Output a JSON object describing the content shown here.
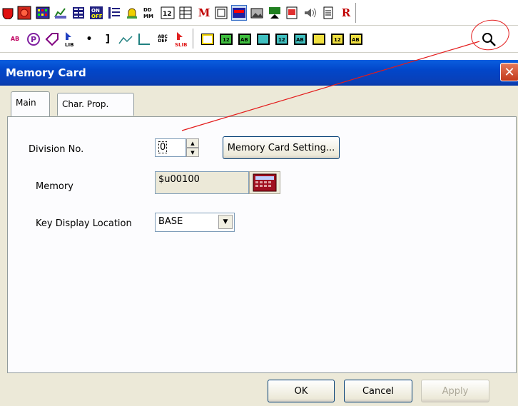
{
  "toolbar": {
    "row1": [
      {
        "icon": "lamp-icon",
        "text": ""
      },
      {
        "icon": "switch-icon",
        "text": ""
      },
      {
        "icon": "grid-display-icon",
        "text": ""
      },
      {
        "icon": "graph-icon",
        "text": ""
      },
      {
        "icon": "bar-list-icon",
        "text": ""
      },
      {
        "icon": "on-off-icon",
        "text": ""
      },
      {
        "icon": "list-icon",
        "text": ""
      },
      {
        "icon": "alarm-bell-icon",
        "text": ""
      },
      {
        "icon": "date-time-icon",
        "text": ""
      },
      {
        "icon": "numeric-input-icon",
        "text": ""
      },
      {
        "icon": "data-table-icon",
        "text": ""
      },
      {
        "icon": "message-icon",
        "text": "M"
      },
      {
        "icon": "window-icon",
        "text": ""
      },
      {
        "icon": "monitor-icon",
        "text": ""
      },
      {
        "icon": "picture-icon",
        "text": ""
      },
      {
        "icon": "parts-icon",
        "text": ""
      },
      {
        "icon": "report-icon",
        "text": ""
      },
      {
        "icon": "sound-icon",
        "text": ""
      },
      {
        "icon": "document-icon",
        "text": ""
      },
      {
        "icon": "recipe-icon",
        "text": "R"
      }
    ],
    "row2": [
      {
        "icon": "char-display-icon",
        "text": "AB"
      },
      {
        "icon": "p-circle-icon",
        "text": "P"
      },
      {
        "icon": "tag-icon",
        "text": ""
      },
      {
        "icon": "lib-icon",
        "text": "LIB"
      },
      {
        "icon": "dot-icon",
        "text": "•"
      },
      {
        "icon": "bracket-icon",
        "text": "]"
      },
      {
        "icon": "trend-line-icon",
        "text": ""
      },
      {
        "icon": "corner-line-icon",
        "text": ""
      },
      {
        "icon": "abc-def-icon",
        "text": "ABC DEF"
      },
      {
        "icon": "slib-icon",
        "text": "SLIB"
      }
    ],
    "row2_keys": [
      {
        "icon": "key-blank-yellow-icon",
        "text": ""
      },
      {
        "icon": "key-12-green-icon",
        "text": "12"
      },
      {
        "icon": "key-ab-green-icon",
        "text": "AB"
      },
      {
        "icon": "key-blank-teal-icon",
        "text": ""
      },
      {
        "icon": "key-12-teal-icon",
        "text": "12"
      },
      {
        "icon": "key-ab-teal-icon",
        "text": "AB"
      },
      {
        "icon": "key-blank-yellow-2-icon",
        "text": ""
      },
      {
        "icon": "key-12-yellow-icon",
        "text": "12"
      },
      {
        "icon": "key-ab-yellow-icon",
        "text": "AB"
      },
      {
        "icon": "magnifier-icon",
        "text": ""
      }
    ]
  },
  "dialog": {
    "title": "Memory Card",
    "close_label": "✕",
    "tabs": [
      {
        "label": "Main",
        "active": true
      },
      {
        "label": "Char. Prop.",
        "active": false
      }
    ],
    "fields": {
      "division_label": "Division No.",
      "division_value": "0",
      "memory_card_setting_button": "Memory Card Setting...",
      "memory_label": "Memory",
      "memory_value": "$u00100",
      "key_display_label": "Key Display Location",
      "key_display_value": "BASE"
    },
    "buttons": {
      "ok": "OK",
      "cancel": "Cancel",
      "apply": "Apply"
    }
  },
  "colors": {
    "accent_title": "#0a3fb5",
    "annotation": "#e31b1b",
    "dialog_bg": "#ece9d8"
  }
}
